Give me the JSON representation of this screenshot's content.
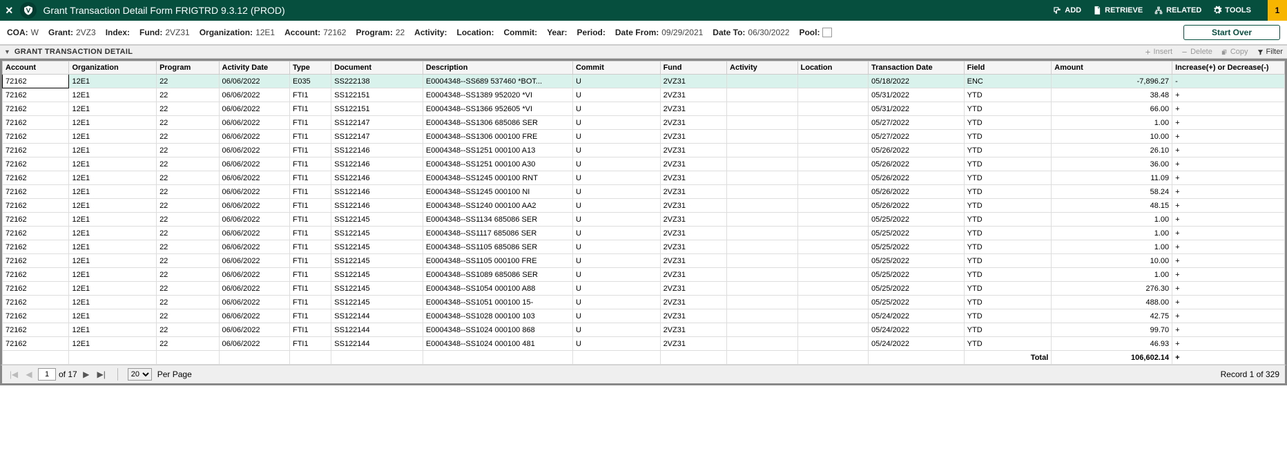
{
  "header": {
    "title": "Grant Transaction Detail Form FRIGTRD 9.3.12 (PROD)",
    "add": "ADD",
    "retrieve": "RETRIEVE",
    "related": "RELATED",
    "tools": "TOOLS",
    "notif_count": "1"
  },
  "params": {
    "coa_label": "COA:",
    "coa_val": "W",
    "grant_label": "Grant:",
    "grant_val": "2VZ3",
    "index_label": "Index:",
    "fund_label": "Fund:",
    "fund_val": "2VZ31",
    "org_label": "Organization:",
    "org_val": "12E1",
    "acct_label": "Account:",
    "acct_val": "72162",
    "prog_label": "Program:",
    "prog_val": "22",
    "activity_label": "Activity:",
    "location_label": "Location:",
    "commit_label": "Commit:",
    "year_label": "Year:",
    "period_label": "Period:",
    "datefrom_label": "Date From:",
    "datefrom_val": "09/29/2021",
    "dateto_label": "Date To:",
    "dateto_val": "06/30/2022",
    "pool_label": "Pool:",
    "start_over": "Start Over"
  },
  "section": {
    "title": "GRANT TRANSACTION DETAIL",
    "insert": "Insert",
    "delete": "Delete",
    "copy": "Copy",
    "filter": "Filter"
  },
  "columns": [
    "Account",
    "Organization",
    "Program",
    "Activity Date",
    "Type",
    "Document",
    "Description",
    "Commit",
    "Fund",
    "Activity",
    "Location",
    "Transaction Date",
    "Field",
    "Amount",
    "Increase(+) or Decrease(-)"
  ],
  "rows": [
    {
      "acct": "72162",
      "org": "12E1",
      "prog": "22",
      "adate": "06/06/2022",
      "type": "E035",
      "doc": "SS222138",
      "desc": "E0004348--SS689 537460 *BOT...",
      "commit": "U",
      "fund": "2VZ31",
      "act": "",
      "loc": "",
      "tdate": "05/18/2022",
      "field": "ENC",
      "amt": "-7,896.27",
      "inc": "-"
    },
    {
      "acct": "72162",
      "org": "12E1",
      "prog": "22",
      "adate": "06/06/2022",
      "type": "FTI1",
      "doc": "SS122151",
      "desc": "E0004348--SS1389 952020 *VI",
      "commit": "U",
      "fund": "2VZ31",
      "act": "",
      "loc": "",
      "tdate": "05/31/2022",
      "field": "YTD",
      "amt": "38.48",
      "inc": "+"
    },
    {
      "acct": "72162",
      "org": "12E1",
      "prog": "22",
      "adate": "06/06/2022",
      "type": "FTI1",
      "doc": "SS122151",
      "desc": "E0004348--SS1366 952605 *VI",
      "commit": "U",
      "fund": "2VZ31",
      "act": "",
      "loc": "",
      "tdate": "05/31/2022",
      "field": "YTD",
      "amt": "66.00",
      "inc": "+"
    },
    {
      "acct": "72162",
      "org": "12E1",
      "prog": "22",
      "adate": "06/06/2022",
      "type": "FTI1",
      "doc": "SS122147",
      "desc": "E0004348--SS1306 685086 SER",
      "commit": "U",
      "fund": "2VZ31",
      "act": "",
      "loc": "",
      "tdate": "05/27/2022",
      "field": "YTD",
      "amt": "1.00",
      "inc": "+"
    },
    {
      "acct": "72162",
      "org": "12E1",
      "prog": "22",
      "adate": "06/06/2022",
      "type": "FTI1",
      "doc": "SS122147",
      "desc": "E0004348--SS1306 000100 FRE",
      "commit": "U",
      "fund": "2VZ31",
      "act": "",
      "loc": "",
      "tdate": "05/27/2022",
      "field": "YTD",
      "amt": "10.00",
      "inc": "+"
    },
    {
      "acct": "72162",
      "org": "12E1",
      "prog": "22",
      "adate": "06/06/2022",
      "type": "FTI1",
      "doc": "SS122146",
      "desc": "E0004348--SS1251 000100 A13",
      "commit": "U",
      "fund": "2VZ31",
      "act": "",
      "loc": "",
      "tdate": "05/26/2022",
      "field": "YTD",
      "amt": "26.10",
      "inc": "+"
    },
    {
      "acct": "72162",
      "org": "12E1",
      "prog": "22",
      "adate": "06/06/2022",
      "type": "FTI1",
      "doc": "SS122146",
      "desc": "E0004348--SS1251 000100 A30",
      "commit": "U",
      "fund": "2VZ31",
      "act": "",
      "loc": "",
      "tdate": "05/26/2022",
      "field": "YTD",
      "amt": "36.00",
      "inc": "+"
    },
    {
      "acct": "72162",
      "org": "12E1",
      "prog": "22",
      "adate": "06/06/2022",
      "type": "FTI1",
      "doc": "SS122146",
      "desc": "E0004348--SS1245 000100 RNT",
      "commit": "U",
      "fund": "2VZ31",
      "act": "",
      "loc": "",
      "tdate": "05/26/2022",
      "field": "YTD",
      "amt": "11.09",
      "inc": "+"
    },
    {
      "acct": "72162",
      "org": "12E1",
      "prog": "22",
      "adate": "06/06/2022",
      "type": "FTI1",
      "doc": "SS122146",
      "desc": "E0004348--SS1245 000100 NI",
      "commit": "U",
      "fund": "2VZ31",
      "act": "",
      "loc": "",
      "tdate": "05/26/2022",
      "field": "YTD",
      "amt": "58.24",
      "inc": "+"
    },
    {
      "acct": "72162",
      "org": "12E1",
      "prog": "22",
      "adate": "06/06/2022",
      "type": "FTI1",
      "doc": "SS122146",
      "desc": "E0004348--SS1240 000100 AA2",
      "commit": "U",
      "fund": "2VZ31",
      "act": "",
      "loc": "",
      "tdate": "05/26/2022",
      "field": "YTD",
      "amt": "48.15",
      "inc": "+"
    },
    {
      "acct": "72162",
      "org": "12E1",
      "prog": "22",
      "adate": "06/06/2022",
      "type": "FTI1",
      "doc": "SS122145",
      "desc": "E0004348--SS1134 685086 SER",
      "commit": "U",
      "fund": "2VZ31",
      "act": "",
      "loc": "",
      "tdate": "05/25/2022",
      "field": "YTD",
      "amt": "1.00",
      "inc": "+"
    },
    {
      "acct": "72162",
      "org": "12E1",
      "prog": "22",
      "adate": "06/06/2022",
      "type": "FTI1",
      "doc": "SS122145",
      "desc": "E0004348--SS1117 685086 SER",
      "commit": "U",
      "fund": "2VZ31",
      "act": "",
      "loc": "",
      "tdate": "05/25/2022",
      "field": "YTD",
      "amt": "1.00",
      "inc": "+"
    },
    {
      "acct": "72162",
      "org": "12E1",
      "prog": "22",
      "adate": "06/06/2022",
      "type": "FTI1",
      "doc": "SS122145",
      "desc": "E0004348--SS1105 685086 SER",
      "commit": "U",
      "fund": "2VZ31",
      "act": "",
      "loc": "",
      "tdate": "05/25/2022",
      "field": "YTD",
      "amt": "1.00",
      "inc": "+"
    },
    {
      "acct": "72162",
      "org": "12E1",
      "prog": "22",
      "adate": "06/06/2022",
      "type": "FTI1",
      "doc": "SS122145",
      "desc": "E0004348--SS1105 000100 FRE",
      "commit": "U",
      "fund": "2VZ31",
      "act": "",
      "loc": "",
      "tdate": "05/25/2022",
      "field": "YTD",
      "amt": "10.00",
      "inc": "+"
    },
    {
      "acct": "72162",
      "org": "12E1",
      "prog": "22",
      "adate": "06/06/2022",
      "type": "FTI1",
      "doc": "SS122145",
      "desc": "E0004348--SS1089 685086 SER",
      "commit": "U",
      "fund": "2VZ31",
      "act": "",
      "loc": "",
      "tdate": "05/25/2022",
      "field": "YTD",
      "amt": "1.00",
      "inc": "+"
    },
    {
      "acct": "72162",
      "org": "12E1",
      "prog": "22",
      "adate": "06/06/2022",
      "type": "FTI1",
      "doc": "SS122145",
      "desc": "E0004348--SS1054 000100 A88",
      "commit": "U",
      "fund": "2VZ31",
      "act": "",
      "loc": "",
      "tdate": "05/25/2022",
      "field": "YTD",
      "amt": "276.30",
      "inc": "+"
    },
    {
      "acct": "72162",
      "org": "12E1",
      "prog": "22",
      "adate": "06/06/2022",
      "type": "FTI1",
      "doc": "SS122145",
      "desc": "E0004348--SS1051 000100 15-",
      "commit": "U",
      "fund": "2VZ31",
      "act": "",
      "loc": "",
      "tdate": "05/25/2022",
      "field": "YTD",
      "amt": "488.00",
      "inc": "+"
    },
    {
      "acct": "72162",
      "org": "12E1",
      "prog": "22",
      "adate": "06/06/2022",
      "type": "FTI1",
      "doc": "SS122144",
      "desc": "E0004348--SS1028 000100 103",
      "commit": "U",
      "fund": "2VZ31",
      "act": "",
      "loc": "",
      "tdate": "05/24/2022",
      "field": "YTD",
      "amt": "42.75",
      "inc": "+"
    },
    {
      "acct": "72162",
      "org": "12E1",
      "prog": "22",
      "adate": "06/06/2022",
      "type": "FTI1",
      "doc": "SS122144",
      "desc": "E0004348--SS1024 000100 868",
      "commit": "U",
      "fund": "2VZ31",
      "act": "",
      "loc": "",
      "tdate": "05/24/2022",
      "field": "YTD",
      "amt": "99.70",
      "inc": "+"
    },
    {
      "acct": "72162",
      "org": "12E1",
      "prog": "22",
      "adate": "06/06/2022",
      "type": "FTI1",
      "doc": "SS122144",
      "desc": "E0004348--SS1024 000100 481",
      "commit": "U",
      "fund": "2VZ31",
      "act": "",
      "loc": "",
      "tdate": "05/24/2022",
      "field": "YTD",
      "amt": "46.93",
      "inc": "+"
    }
  ],
  "total": {
    "label": "Total",
    "amt": "106,602.14",
    "inc": "+"
  },
  "footer": {
    "page": "1",
    "of": "of 17",
    "perpage_selected": "20",
    "perpage_label": "Per Page",
    "record": "Record 1 of 329"
  }
}
